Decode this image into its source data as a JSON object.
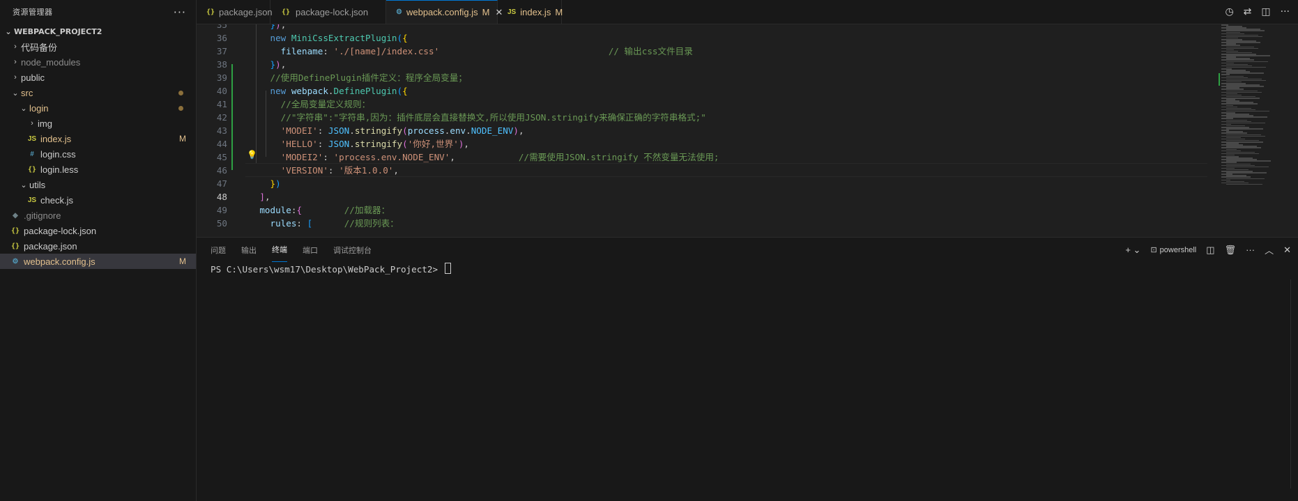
{
  "sidebar": {
    "title": "资源管理器",
    "more": "···",
    "project": "WEBPACK_PROJECT2",
    "items": [
      {
        "label": "代码备份",
        "chev": "›",
        "icon": ""
      },
      {
        "label": "node_modules",
        "chev": "›",
        "icon": ""
      },
      {
        "label": "public",
        "chev": "›",
        "icon": ""
      },
      {
        "label": "src",
        "chev": "⌄",
        "icon": ""
      },
      {
        "label": "login",
        "chev": "⌄",
        "icon": ""
      },
      {
        "label": "img",
        "chev": "›",
        "icon": ""
      },
      {
        "label": "index.js",
        "icon": "JS",
        "badge": "M"
      },
      {
        "label": "login.css",
        "icon": "#"
      },
      {
        "label": "login.less",
        "icon": "{}"
      },
      {
        "label": "utils",
        "chev": "⌄",
        "icon": ""
      },
      {
        "label": "check.js",
        "icon": "JS"
      },
      {
        "label": ".gitignore",
        "icon": "◆"
      },
      {
        "label": "package-lock.json",
        "icon": "{}"
      },
      {
        "label": "package.json",
        "icon": "{}"
      },
      {
        "label": "webpack.config.js",
        "icon": "⚙",
        "badge": "M"
      }
    ]
  },
  "tabs": [
    {
      "label": "package.json",
      "icon": "{}"
    },
    {
      "label": "package-lock.json",
      "icon": "{}"
    },
    {
      "label": "webpack.config.js",
      "icon": "⚙",
      "mod": "M",
      "close": "✕"
    },
    {
      "label": "index.js",
      "icon": "JS",
      "mod": "M"
    }
  ],
  "editor": {
    "lines": [
      {
        "n": "35",
        "t": [
          {
            "c": "",
            "v": "      "
          },
          {
            "c": "br3",
            "v": "}"
          },
          {
            "c": "br2",
            "v": ")"
          },
          {
            "c": "",
            "v": ","
          }
        ]
      },
      {
        "n": "36",
        "t": [
          {
            "c": "",
            "v": "      "
          },
          {
            "c": "kw",
            "v": "new "
          },
          {
            "c": "cls",
            "v": "MiniCssExtractPlugin"
          },
          {
            "c": "br3",
            "v": "("
          },
          {
            "c": "br1",
            "v": "{"
          }
        ]
      },
      {
        "n": "37",
        "t": [
          {
            "c": "",
            "v": "        "
          },
          {
            "c": "prop",
            "v": "filename"
          },
          {
            "c": "",
            "v": ": "
          },
          {
            "c": "str",
            "v": "'./[name]/index.css'"
          },
          {
            "c": "",
            "v": "                                "
          },
          {
            "c": "cm",
            "v": "// 输出css文件目录"
          }
        ]
      },
      {
        "n": "38",
        "t": [
          {
            "c": "",
            "v": "      "
          },
          {
            "c": "br3",
            "v": "}"
          },
          {
            "c": "br2",
            "v": ")"
          },
          {
            "c": "",
            "v": ","
          }
        ]
      },
      {
        "n": "39",
        "t": [
          {
            "c": "",
            "v": "      "
          },
          {
            "c": "cm",
            "v": "//使用DefinePlugin插件定义：程序全局变量；"
          }
        ]
      },
      {
        "n": "40",
        "t": [
          {
            "c": "",
            "v": "      "
          },
          {
            "c": "kw",
            "v": "new "
          },
          {
            "c": "prop",
            "v": "webpack"
          },
          {
            "c": "",
            "v": "."
          },
          {
            "c": "cls",
            "v": "DefinePlugin"
          },
          {
            "c": "br3",
            "v": "("
          },
          {
            "c": "br1",
            "v": "{"
          }
        ]
      },
      {
        "n": "41",
        "t": [
          {
            "c": "",
            "v": "        "
          },
          {
            "c": "cm",
            "v": "//全局变量定义规则："
          }
        ]
      },
      {
        "n": "42",
        "t": [
          {
            "c": "",
            "v": "        "
          },
          {
            "c": "cm",
            "v": "//\"字符串\":\"字符串,因为：插件底层会直接替换文,所以使用JSON.stringify来确保正确的字符串格式;\""
          }
        ]
      },
      {
        "n": "43",
        "t": [
          {
            "c": "",
            "v": "        "
          },
          {
            "c": "str",
            "v": "'MODEI'"
          },
          {
            "c": "",
            "v": ": "
          },
          {
            "c": "cst",
            "v": "JSON"
          },
          {
            "c": "",
            "v": "."
          },
          {
            "c": "fn",
            "v": "stringify"
          },
          {
            "c": "br2",
            "v": "("
          },
          {
            "c": "prop",
            "v": "process"
          },
          {
            "c": "",
            "v": "."
          },
          {
            "c": "prop",
            "v": "env"
          },
          {
            "c": "",
            "v": "."
          },
          {
            "c": "cst",
            "v": "NODE_ENV"
          },
          {
            "c": "br2",
            "v": ")"
          },
          {
            "c": "",
            "v": ","
          }
        ]
      },
      {
        "n": "44",
        "t": [
          {
            "c": "",
            "v": "        "
          },
          {
            "c": "str",
            "v": "'HELLO'"
          },
          {
            "c": "",
            "v": ": "
          },
          {
            "c": "cst",
            "v": "JSON"
          },
          {
            "c": "",
            "v": "."
          },
          {
            "c": "fn",
            "v": "stringify"
          },
          {
            "c": "br2",
            "v": "("
          },
          {
            "c": "str",
            "v": "'你好,世界'"
          },
          {
            "c": "br2",
            "v": ")"
          },
          {
            "c": "",
            "v": ","
          }
        ]
      },
      {
        "n": "45",
        "t": [
          {
            "c": "",
            "v": "        "
          },
          {
            "c": "str",
            "v": "'MODEI2'"
          },
          {
            "c": "",
            "v": ": "
          },
          {
            "c": "str",
            "v": "'process.env.NODE_ENV'"
          },
          {
            "c": "",
            "v": ",            "
          },
          {
            "c": "cm",
            "v": "//需要使用JSON.stringify 不然变量无法使用;"
          }
        ]
      },
      {
        "n": "46",
        "t": [
          {
            "c": "",
            "v": "        "
          },
          {
            "c": "str",
            "v": "'VERSION'"
          },
          {
            "c": "",
            "v": ": "
          },
          {
            "c": "str",
            "v": "'版本1.0.0'"
          },
          {
            "c": "",
            "v": ","
          }
        ]
      },
      {
        "n": "47",
        "t": [
          {
            "c": "",
            "v": "      "
          },
          {
            "c": "br1",
            "v": "}"
          },
          {
            "c": "br3",
            "v": ")"
          }
        ]
      },
      {
        "n": "48",
        "t": [
          {
            "c": "",
            "v": "    "
          },
          {
            "c": "br2",
            "v": "]"
          },
          {
            "c": "",
            "v": ","
          }
        ]
      },
      {
        "n": "49",
        "t": [
          {
            "c": "",
            "v": "    "
          },
          {
            "c": "prop",
            "v": "module"
          },
          {
            "c": "",
            "v": ":"
          },
          {
            "c": "br2",
            "v": "{"
          },
          {
            "c": "",
            "v": "        "
          },
          {
            "c": "cm",
            "v": "//加载器："
          }
        ]
      },
      {
        "n": "50",
        "t": [
          {
            "c": "",
            "v": "      "
          },
          {
            "c": "prop",
            "v": "rules"
          },
          {
            "c": "",
            "v": ": "
          },
          {
            "c": "br3",
            "v": "["
          },
          {
            "c": "",
            "v": "      "
          },
          {
            "c": "cm",
            "v": "//规则列表："
          }
        ]
      }
    ]
  },
  "panel": {
    "tabs": [
      "问题",
      "输出",
      "终端",
      "端口",
      "调试控制台"
    ],
    "active": 2,
    "shell_label": "powershell",
    "prompt": "PS C:\\Users\\wsm17\\Desktop\\WebPack_Project2> "
  }
}
